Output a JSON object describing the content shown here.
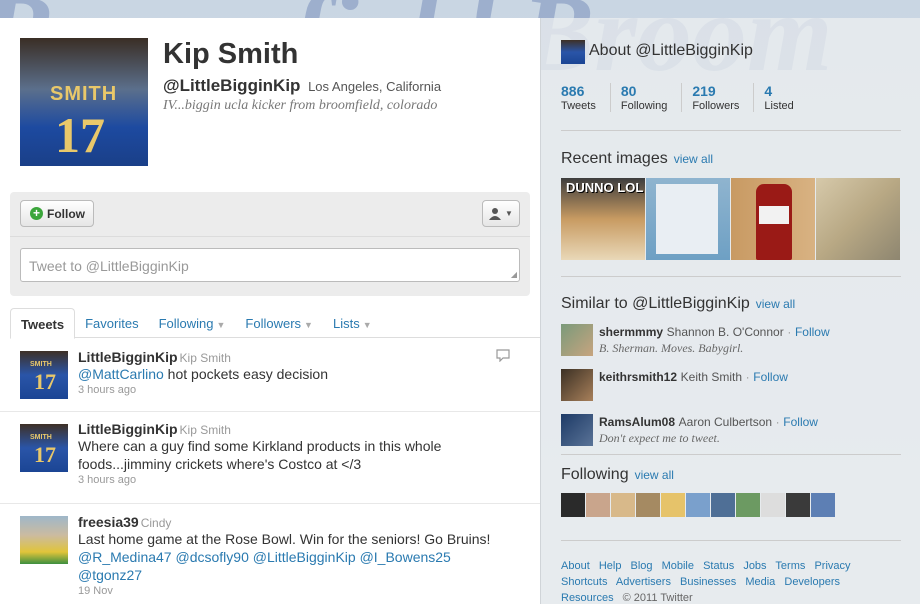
{
  "profile": {
    "full_name": "Kip Smith",
    "handle": "@LittleBigginKip",
    "location": "Los Angeles, California",
    "bio": "IV...biggin ucla kicker from broomfield, colorado",
    "jersey_name": "SMITH",
    "jersey_number": "17"
  },
  "actions": {
    "follow_label": "Follow",
    "tweet_placeholder": "Tweet to @LittleBigginKip"
  },
  "tabs": [
    {
      "label": "Tweets"
    },
    {
      "label": "Favorites"
    },
    {
      "label": "Following"
    },
    {
      "label": "Followers"
    },
    {
      "label": "Lists"
    }
  ],
  "tweets": [
    {
      "user": "LittleBigginKip",
      "name": "Kip Smith",
      "text_mention": "@MattCarlino",
      "text": " hot pockets easy decision",
      "time": "3 hours ago"
    },
    {
      "user": "LittleBigginKip",
      "name": "Kip Smith",
      "text": "Where can a guy find some Kirkland products in this whole foods...jimminy crickets where's Costco at </3",
      "time": "3 hours ago"
    },
    {
      "user": "freesia39",
      "name": "Cindy",
      "text": "Last home game at the Rose Bowl. Win for the seniors! Go Bruins!",
      "mentions": [
        "@R_Medina47",
        "@dcsofly90",
        "@LittleBigginKip",
        "@I_Bowens25",
        "@tgonz27"
      ],
      "time": "19 Nov"
    }
  ],
  "sidebar": {
    "about_title": "About @LittleBigginKip",
    "stats": [
      {
        "value": "886",
        "label": "Tweets"
      },
      {
        "value": "80",
        "label": "Following"
      },
      {
        "value": "219",
        "label": "Followers"
      },
      {
        "value": "4",
        "label": "Listed"
      }
    ],
    "recent_images_title": "Recent images",
    "view_all": "view all",
    "image1_caption": "DUNNO LOL",
    "similar_title": "Similar to @LittleBigginKip",
    "similar": [
      {
        "user": "shermmmy",
        "name": "Shannon B. O'Connor",
        "follow": "Follow",
        "bio": "B. Sherman. Moves. Babygirl."
      },
      {
        "user": "keithrsmith12",
        "name": "Keith Smith",
        "follow": "Follow",
        "bio": ""
      },
      {
        "user": "RamsAlum08",
        "name": "Aaron Culbertson",
        "follow": "Follow",
        "bio": "Don't expect me to tweet."
      }
    ],
    "following_title": "Following",
    "following_colors": [
      "#2a2a2a",
      "#c9a58c",
      "#d8b98a",
      "#a58a62",
      "#e6c36a",
      "#7aa0cc",
      "#4f6f96",
      "#6c9a62",
      "#dddddd",
      "#3a3a3a",
      "#5d7fb4"
    ],
    "footer_links": [
      "About",
      "Help",
      "Blog",
      "Mobile",
      "Status",
      "Jobs",
      "Terms",
      "Privacy",
      "Shortcuts",
      "Advertisers",
      "Businesses",
      "Media",
      "Developers",
      "Resources"
    ],
    "copyright": "© 2011 Twitter"
  }
}
